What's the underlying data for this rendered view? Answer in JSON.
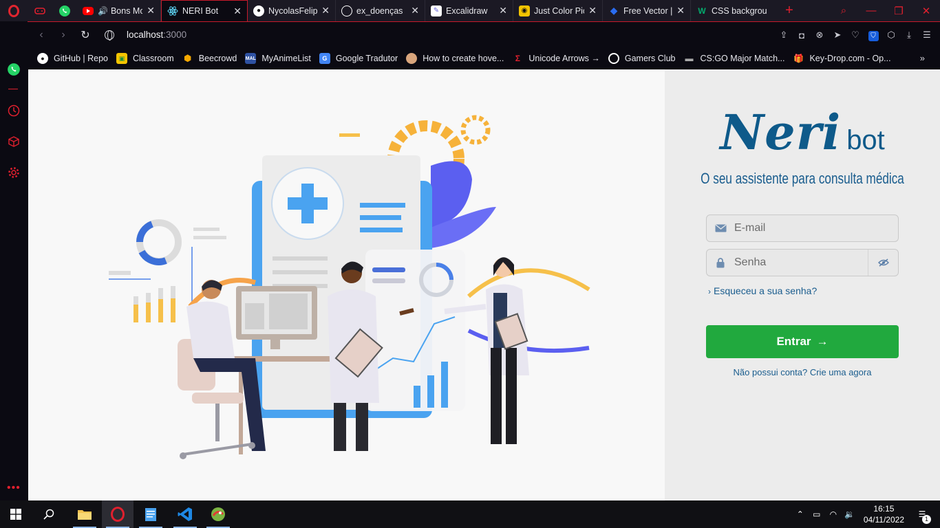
{
  "browser": {
    "tabs": [
      {
        "title": "Bons Mom",
        "fav": "youtube",
        "color": "#ff0000"
      },
      {
        "title": "NERI Bot",
        "fav": "react",
        "color": "#61dafb",
        "active": true
      },
      {
        "title": "NycolasFelipe",
        "fav": "github",
        "color": "#ffffff"
      },
      {
        "title": "ex_doenças",
        "fav": "globe",
        "color": "#ffffff"
      },
      {
        "title": "Excalidraw",
        "fav": "excalidraw",
        "color": "#ffffff"
      },
      {
        "title": "Just Color Pick",
        "fav": "jcp",
        "color": "#f4c400"
      },
      {
        "title": "Free Vector | M",
        "fav": "freepik",
        "color": "#2a6cf0"
      },
      {
        "title": "CSS backgrou",
        "fav": "w3",
        "color": "#04aa6d"
      }
    ],
    "url_host": "localhost",
    "url_port": ":3000",
    "bookmarks": [
      {
        "label": "GitHub | Repo",
        "color": "#ffffff"
      },
      {
        "label": "Classroom",
        "color": "#f4c400"
      },
      {
        "label": "Beecrowd",
        "color": "#f6a800"
      },
      {
        "label": "MyAnimeList",
        "color": "#2e51a2"
      },
      {
        "label": "Google Tradutor",
        "color": "#4285f4"
      },
      {
        "label": "How to create hove...",
        "color": "#d9a57c"
      },
      {
        "label": "Unicode Arrows →",
        "color": "#e0202e"
      },
      {
        "label": "Gamers Club",
        "color": "#ffffff"
      },
      {
        "label": "CS:GO Major Match...",
        "color": "#888888"
      },
      {
        "label": "Key-Drop.com - Op...",
        "color": "#f4b400"
      }
    ]
  },
  "login": {
    "logo_neri": "Neri",
    "logo_bot": "bot",
    "tagline": "O seu assistente para consulta médica",
    "email_placeholder": "E-mail",
    "password_placeholder": "Senha",
    "forgot": "Esqueceu a sua senha?",
    "submit": "Entrar",
    "signup": "Não possui conta? Crie uma agora"
  },
  "taskbar": {
    "time": "16:15",
    "date": "04/11/2022",
    "notifications": "1"
  },
  "colors": {
    "accent": "#0e5a8a",
    "button": "#21a93e",
    "opera": "#e0202e"
  }
}
